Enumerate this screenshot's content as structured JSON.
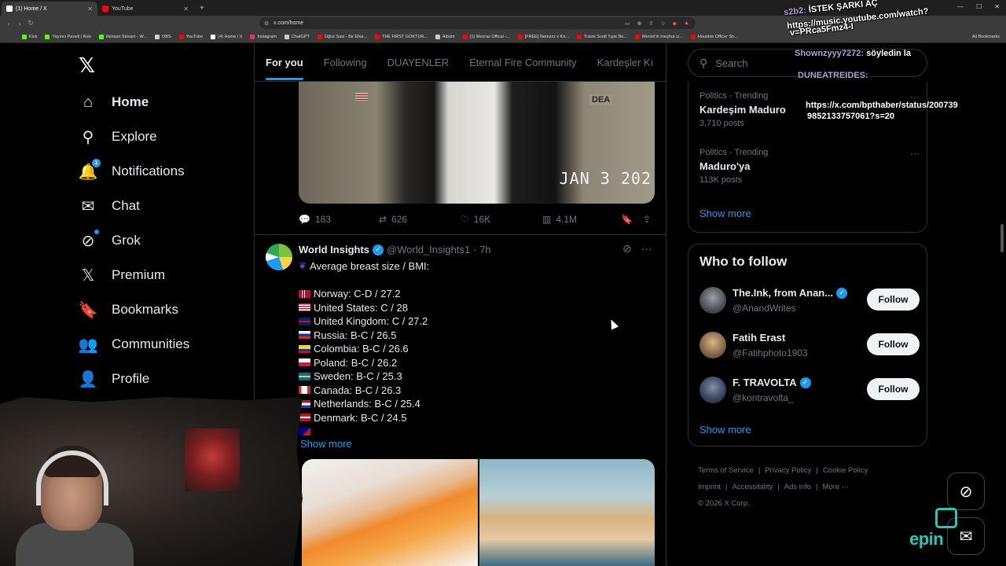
{
  "browser": {
    "tabs": [
      {
        "title": "(1) Home / X",
        "color": "#ffffff",
        "active": true
      },
      {
        "title": "YouTube",
        "color": "#ff0000",
        "active": false
      }
    ],
    "new_tab": "+",
    "url": "x.com/home",
    "bookmarks": [
      {
        "label": "Kick",
        "color": "#53fc18"
      },
      {
        "label": "Yayıncı Paneli | Kick",
        "color": "#53fc18"
      },
      {
        "label": "ilkinsan Stream - W...",
        "color": "#53fc18"
      },
      {
        "label": "OBS",
        "color": "#cccccc"
      },
      {
        "label": "YouTube",
        "color": "#ff0000"
      },
      {
        "label": "(4) Home / X",
        "color": "#ffffff"
      },
      {
        "label": "Instagram",
        "color": "#e1306c"
      },
      {
        "label": "ChatGPT",
        "color": "#cccccc"
      },
      {
        "label": "Oğuz Sasi - Bir Efsa...",
        "color": "#ff0000"
      },
      {
        "label": "THE FIRST GOKTUR...",
        "color": "#ff0000"
      },
      {
        "label": "Albüm",
        "color": "#cccccc"
      },
      {
        "label": "(1) Mezraz Offical -...",
        "color": "#ff0000"
      },
      {
        "label": "[FREE] Nemzzz x Kn...",
        "color": "#ff0000"
      },
      {
        "label": "Travis Scott Type Be...",
        "color": "#ff0000"
      },
      {
        "label": "Mersin'in meşhur ci...",
        "color": "#ff0000"
      },
      {
        "label": "Houston Officer Sh...",
        "color": "#ff0000"
      }
    ],
    "all_bookmarks": "All Bookmarks"
  },
  "nav": {
    "items": [
      {
        "label": "Home",
        "icon": "home-icon",
        "glyph": "⌂",
        "bold": true
      },
      {
        "label": "Explore",
        "icon": "search-icon",
        "glyph": "⚲"
      },
      {
        "label": "Notifications",
        "icon": "bell-icon",
        "glyph": "🔔",
        "badge": "1"
      },
      {
        "label": "Chat",
        "icon": "mail-icon",
        "glyph": "✉"
      },
      {
        "label": "Grok",
        "icon": "grok-icon",
        "glyph": "⊘",
        "dot": true
      },
      {
        "label": "Premium",
        "icon": "x-logo-icon",
        "glyph": "𝕏"
      },
      {
        "label": "Bookmarks",
        "icon": "bookmark-icon",
        "glyph": "🔖"
      },
      {
        "label": "Communities",
        "icon": "communities-icon",
        "glyph": "👥"
      },
      {
        "label": "Profile",
        "icon": "profile-icon",
        "glyph": "👤"
      }
    ]
  },
  "feed": {
    "tabs": [
      "For you",
      "Following",
      "DUAYENLER",
      "Eternal Fire Community",
      "Kardeşler Kı"
    ],
    "tweet1": {
      "media_stamp": "JAN  3  202",
      "media_label": "DEA",
      "replies": "183",
      "reposts": "626",
      "likes": "16K",
      "views": "4.1M"
    },
    "tweet2": {
      "name": "World Insights",
      "handle": "@World_Insights1",
      "time": "· 7h",
      "intro": "Average breast size / BMI:",
      "lines": [
        {
          "text": "Norway: C-D / 27.2",
          "flag": "linear-gradient(90deg,#ba0c2f 0 30%,#fff 30% 36%,#00205b 36% 46%,#fff 46% 52%,#ba0c2f 52%)"
        },
        {
          "text": "United States: C / 28",
          "flag": "repeating-linear-gradient(180deg,#b22234 0 1.5px,#fff 1.5px 3px)"
        },
        {
          "text": "United Kingdom: C / 27.2",
          "flag": "linear-gradient(180deg,#012169 0 40%,#c8102e 40% 60%,#012169 60%)"
        },
        {
          "text": "Russia: B-C / 26.5",
          "flag": "linear-gradient(180deg,#fff 0 33%,#0039a6 33% 66%,#d52b1e 66%)"
        },
        {
          "text": "Colombia: B-C / 26.6",
          "flag": "linear-gradient(180deg,#fcd116 0 50%,#003893 50% 75%,#ce1126 75%)"
        },
        {
          "text": "Poland: B-C / 26.2",
          "flag": "linear-gradient(180deg,#fff 0 50%,#dc143c 50%)"
        },
        {
          "text": "Sweden: B-C / 25.3",
          "flag": "linear-gradient(180deg,#006aa7 0 40%,#fecc00 40% 60%,#006aa7 60%)"
        },
        {
          "text": "Canada: B-C / 26.3",
          "flag": "linear-gradient(90deg,#d52b1e 0 25%,#fff 25% 75%,#d52b1e 75%)"
        },
        {
          "text": "Netherlands: B-C / 25.4",
          "flag": "linear-gradient(180deg,#ae1c28 0 33%,#fff 33% 66%,#21468b 66%)"
        },
        {
          "text": "Denmark: B-C / 24.5",
          "flag": "linear-gradient(180deg,#c8102e 0 40%,#fff 40% 60%,#c8102e 60%)"
        }
      ],
      "show_more": "Show more"
    }
  },
  "sidebar": {
    "search_placeholder": "Search",
    "trends": [
      {
        "category": "Politics · Trending",
        "name": "Kardeşim Maduro",
        "posts": "3,710 posts"
      },
      {
        "category": "Politics · Trending",
        "name": "Maduro'ya",
        "posts": "113K posts"
      }
    ],
    "trends_show_more": "Show more",
    "who_to_follow_title": "Who to follow",
    "follow_suggestions": [
      {
        "name": "The.Ink, from Anan...",
        "handle": "@AnandWrites",
        "verified": true,
        "avatar": "radial-gradient(circle at 50% 40%,#9aa0a6 0%,#4b4f54 60%,#222 100%)"
      },
      {
        "name": "Fatih Erast",
        "handle": "@Fatihphoto1903",
        "verified": false,
        "avatar": "radial-gradient(circle at 50% 40%,#d9b38c 0%,#8a6a4a 55%,#3a2e25 100%)"
      },
      {
        "name": "F. TRAVOLTA",
        "handle": "@kontravolta_",
        "verified": true,
        "avatar": "radial-gradient(circle at 50% 40%,#7f8fa6 0%,#3b4a62 55%,#1b2233 100%)"
      }
    ],
    "follow_label": "Follow",
    "wtf_show_more": "Show more",
    "footer": {
      "links_row1": [
        "Terms of Service",
        "Privacy Policy",
        "Cookie Policy"
      ],
      "links_row2": [
        "Imprint",
        "Accessibility",
        "Ads info",
        "More ···"
      ],
      "copyright": "© 2026 X Corp."
    }
  },
  "stream_overlay": {
    "chat": [
      {
        "user": "s2b2:",
        "msg": "İSTEK ŞARKI AÇ"
      },
      {
        "user": "",
        "msg": "https://music.youtube.com/watch?"
      },
      {
        "user": "",
        "msg": "v=PRca5Fmz4-I"
      },
      {
        "user": "Shownzyyy7272:",
        "msg": "söyledin la"
      },
      {
        "user": "DUNEATREIDES:",
        "msg": ""
      },
      {
        "user": "",
        "msg": "https://x.com/bpthaber/status/200739"
      },
      {
        "user": "",
        "msg": "9852133757061?s=20"
      }
    ],
    "brand": "epin"
  }
}
